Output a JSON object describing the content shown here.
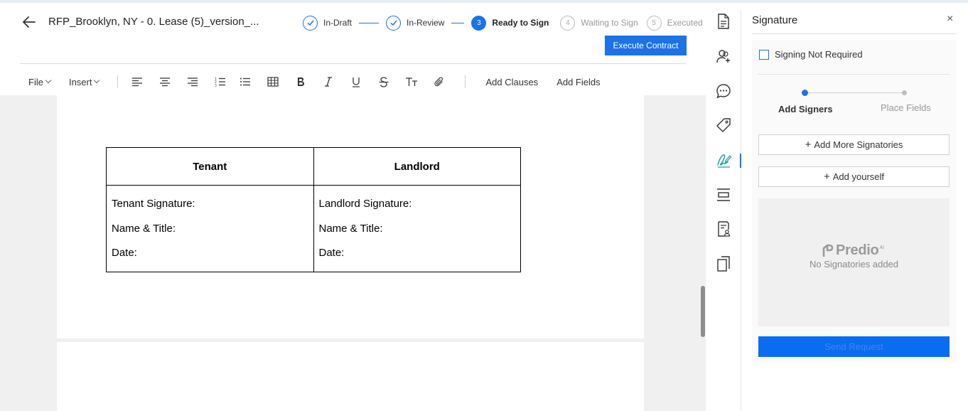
{
  "header": {
    "title": "RFP_Brooklyn, NY - 0. Lease (5)_version_...",
    "execute_label": "Execute Contract"
  },
  "stepper": [
    {
      "num": "",
      "label": "In-Draft",
      "state": "done"
    },
    {
      "num": "",
      "label": "In-Review",
      "state": "done"
    },
    {
      "num": "3",
      "label": "Ready to Sign",
      "state": "active"
    },
    {
      "num": "4",
      "label": "Waiting to Sign",
      "state": "pending"
    },
    {
      "num": "5",
      "label": "Executed",
      "state": "pending"
    }
  ],
  "toolbar": {
    "file": "File",
    "insert": "Insert",
    "add_clauses": "Add Clauses",
    "add_fields": "Add Fields",
    "icons": [
      "align-left-icon",
      "align-center-icon",
      "align-right-icon",
      "numbered-list-icon",
      "bullet-list-icon",
      "table-icon",
      "bold-icon",
      "italic-icon",
      "underline-icon",
      "strikethrough-icon",
      "text-size-icon",
      "attachment-icon"
    ]
  },
  "document": {
    "table": {
      "headers": [
        "Tenant",
        "Landlord"
      ],
      "tenant": [
        "Tenant Signature:",
        "Name & Title:",
        "Date:"
      ],
      "landlord": [
        "Landlord Signature:",
        "Name & Title:",
        "Date:"
      ]
    }
  },
  "rail": {
    "icons": [
      "document-icon",
      "collaborators-icon",
      "comments-icon",
      "tag-icon",
      "signature-icon",
      "section-icon",
      "contract-details-icon",
      "versions-icon"
    ],
    "active": "signature-icon"
  },
  "panel": {
    "title": "Signature",
    "close": "×",
    "signing_not_required": "Signing Not Required",
    "steps": [
      "Add Signers",
      "Place Fields"
    ],
    "add_more": "Add More Signatories",
    "add_yourself": "Add yourself",
    "logo": "Predio",
    "logo_sup": "AI",
    "empty": "No Signatories added",
    "send": "Send Request"
  },
  "colors": {
    "accent": "#1a73e8",
    "send_button": "#0a6cf0"
  }
}
